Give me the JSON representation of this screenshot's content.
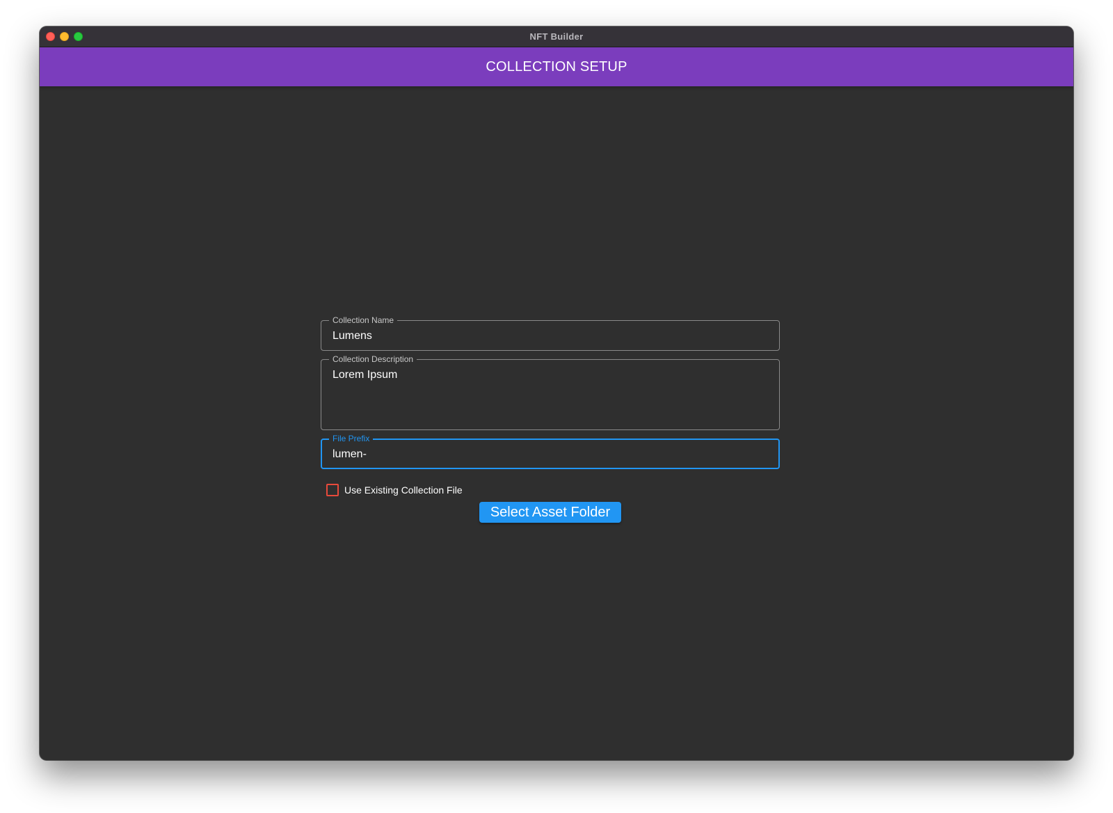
{
  "window": {
    "title": "NFT Builder"
  },
  "appbar": {
    "title": "COLLECTION SETUP",
    "color": "#7b3dbd"
  },
  "form": {
    "collection_name": {
      "label": "Collection Name",
      "value": "Lumens"
    },
    "collection_description": {
      "label": "Collection Description",
      "value": "Lorem Ipsum"
    },
    "file_prefix": {
      "label": "File Prefix",
      "value": "lumen-",
      "focused": true
    },
    "use_existing": {
      "label": "Use Existing Collection File",
      "checked": false
    },
    "select_button": {
      "label": "Select Asset Folder"
    }
  },
  "colors": {
    "accent": "#2196f3",
    "checkbox_border": "#e84a3b",
    "background": "#2f2f2f"
  }
}
